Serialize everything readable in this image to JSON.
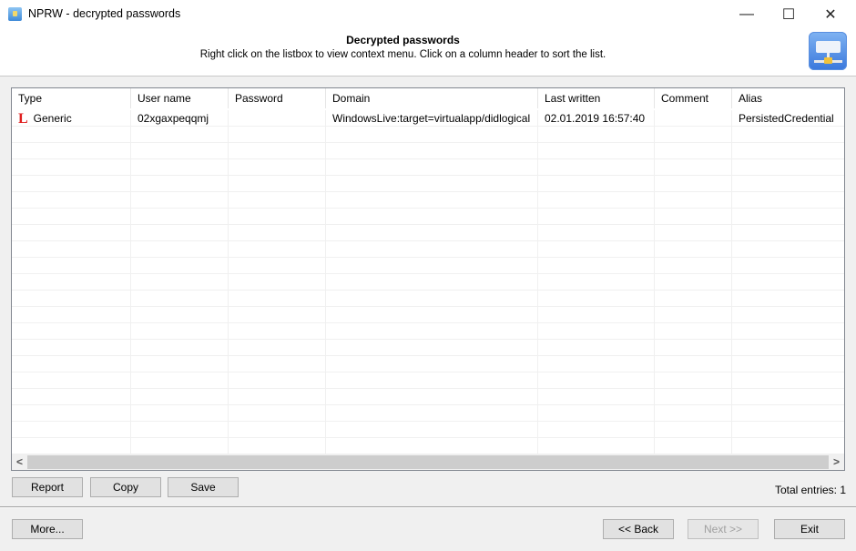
{
  "window": {
    "title": "NPRW - decrypted passwords",
    "controls": {
      "minimize": "—",
      "maximize": "☐",
      "close": "✕"
    }
  },
  "header": {
    "title": "Decrypted passwords",
    "subtitle": "Right click on the listbox to view context menu. Click on a column header to sort the list.",
    "logo_icon": "network-card-icon"
  },
  "table": {
    "columns": [
      "Type",
      "User name",
      "Password",
      "Domain",
      "Last written",
      "Comment",
      "Alias"
    ],
    "rows": [
      {
        "type_icon": "L",
        "type": "Generic",
        "user_name": "02xgaxpeqqmj",
        "password": "",
        "domain": "WindowsLive:target=virtualapp/didlogical",
        "last_written": "02.01.2019  16:57:40",
        "comment": "",
        "alias": "PersistedCredential"
      }
    ],
    "scroll_left": "<",
    "scroll_right": ">"
  },
  "actions": {
    "report": "Report",
    "copy": "Copy",
    "save": "Save"
  },
  "status": {
    "total_entries": "Total entries: 1"
  },
  "footer": {
    "more": "More...",
    "back": "<< Back",
    "next": "Next >>",
    "exit": "Exit"
  }
}
